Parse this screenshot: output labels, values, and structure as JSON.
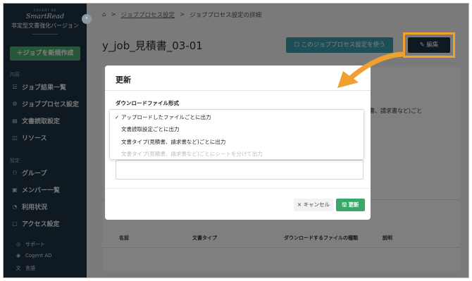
{
  "sidebar": {
    "brand_sub": "COGENT BK",
    "brand_name": "SmartRead",
    "brand_tag": "非定型文書強化バージョン",
    "collapse": "‹",
    "new_job": "＋ジョブを新規作成",
    "content_label": "内容",
    "items": [
      {
        "icon": "☱",
        "label": "ジョブ結果一覧"
      },
      {
        "icon": "⚙",
        "label": "ジョブプロセス設定"
      },
      {
        "icon": "▤",
        "label": "文書読取設定"
      },
      {
        "icon": "◫",
        "label": "リソース"
      }
    ],
    "settings_label": "設定",
    "settings_items": [
      {
        "icon": "⚇",
        "label": "グループ"
      },
      {
        "icon": "▣",
        "label": "メンバー一覧"
      },
      {
        "icon": "◔",
        "label": "利用状況"
      },
      {
        "icon": "▢",
        "label": "アクセス設定"
      }
    ],
    "bottom_items": [
      {
        "icon": "◎",
        "label": "サポート"
      },
      {
        "icon": "◉",
        "label": "Cogent AD"
      },
      {
        "icon": "文",
        "label": "言語"
      }
    ]
  },
  "breadcrumb": {
    "home_icon": "⌂",
    "sep": ">",
    "link": "ジョブプロセス設定",
    "current": "ジョブプロセス設定の詳細"
  },
  "page": {
    "title": "y_job_見積書_03-01",
    "use_button": "☐ このジョブプロセス設定を使う",
    "edit_button": "✎ 編集",
    "bg_snippet": "見積書、請求書など)ごと",
    "columns": [
      "名前",
      "文書タイプ",
      "ダウンロードするファイルの種類",
      "説明"
    ]
  },
  "modal": {
    "title": "更新",
    "label": "ダウンロードファイル形式",
    "options": [
      {
        "label": "アップロードしたファイルごとに出力",
        "selected": true,
        "disabled": false
      },
      {
        "label": "文書読取設定ごとに出力",
        "selected": false,
        "disabled": false
      },
      {
        "label": "文書タイプ(見積書、請求書など)ごとに出力",
        "selected": false,
        "disabled": false
      },
      {
        "label": "文書タイプ(見積書、請求書など)ごとにシートを分けて出力",
        "selected": false,
        "disabled": true
      }
    ],
    "check_mark": "✓",
    "cancel": "× キャンセル",
    "update": "🖫 更新"
  },
  "colors": {
    "sidebar": "#1e3342",
    "accent_green": "#4caf71",
    "teal": "#3d9cac",
    "highlight": "#f0a030"
  }
}
